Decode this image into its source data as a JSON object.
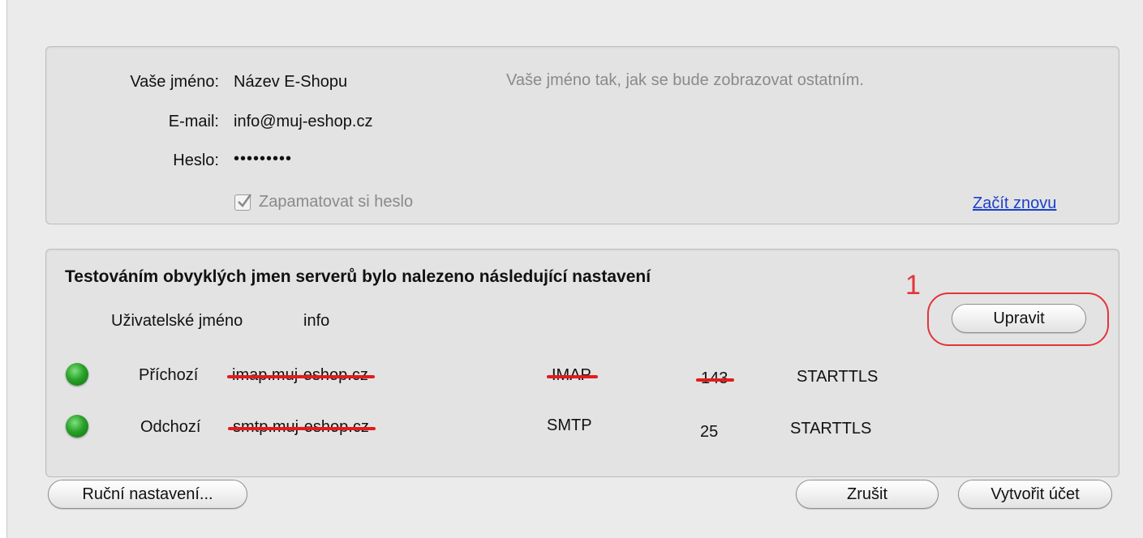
{
  "account": {
    "name_label": "Vaše jméno:",
    "name_value": "Název E-Shopu",
    "name_hint": "Vaše jméno tak, jak se bude zobrazovat ostatním.",
    "email_label": "E-mail:",
    "email_value": "info@muj-eshop.cz",
    "password_label": "Heslo:",
    "password_value": "•••••••••",
    "remember_label": "Zapamatovat si heslo",
    "remember_checked": true,
    "restart_link": "Začít znovu"
  },
  "servers": {
    "title": "Testováním obvyklých jmen serverů bylo nalezeno následující nastavení",
    "username_label": "Uživatelské jméno",
    "username_value": "info",
    "edit_button": "Upravit",
    "annotation_number": "1",
    "rows": [
      {
        "label": "Příchozí",
        "host": "imap.muj-eshop.cz",
        "protocol": "IMAP",
        "port": "143",
        "security": "STARTTLS",
        "status": "green"
      },
      {
        "label": "Odchozí",
        "host": "smtp.muj-eshop.cz",
        "protocol": "SMTP",
        "port": "25",
        "security": "STARTTLS",
        "status": "green"
      }
    ]
  },
  "footer": {
    "manual_button": "Ruční nastavení...",
    "cancel_button": "Zrušit",
    "create_button": "Vytvořit účet"
  },
  "colors": {
    "annotation": "#e3343a",
    "link": "#1c3fc9",
    "status_ok": "#2aa22a"
  }
}
